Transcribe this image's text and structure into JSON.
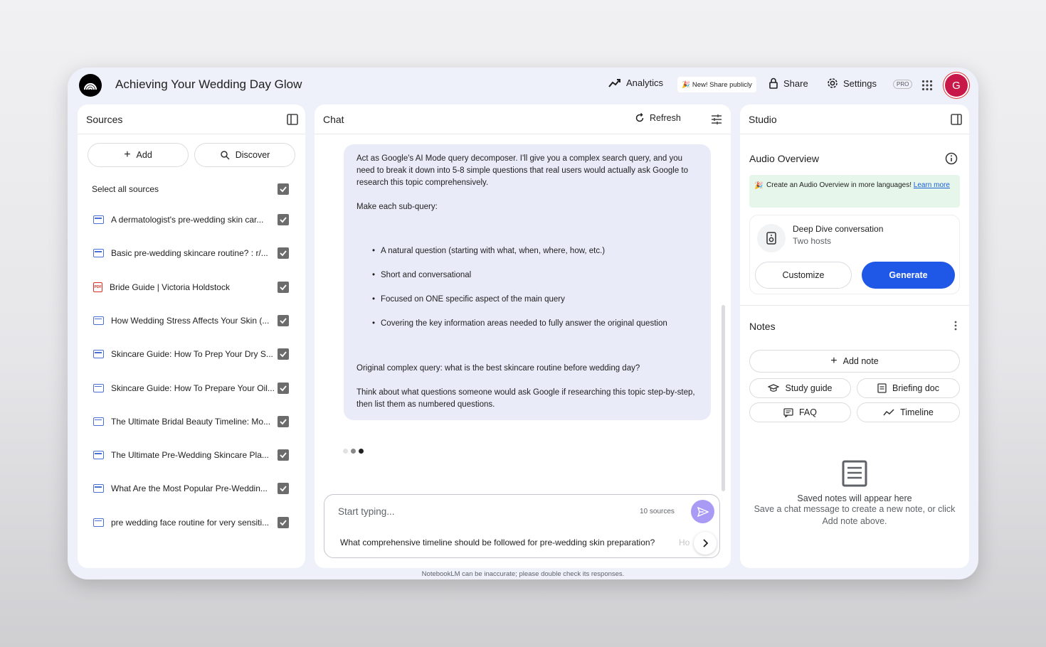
{
  "app": {
    "notebook_title": "Achieving Your Wedding Day Glow"
  },
  "header": {
    "analytics_label": "Analytics",
    "new_share_label": "New! Share publicly",
    "share_label": "Share",
    "settings_label": "Settings",
    "pro_badge": "PRO",
    "avatar_initial": "G"
  },
  "sources": {
    "title": "Sources",
    "add_label": "Add",
    "discover_label": "Discover",
    "select_all_label": "Select all sources",
    "items": [
      {
        "label": "A dermatologist's pre-wedding skin car...",
        "type": "web"
      },
      {
        "label": "Basic pre-wedding skincare routine? : r/...",
        "type": "web"
      },
      {
        "label": "Bride Guide | Victoria Holdstock",
        "type": "pdf"
      },
      {
        "label": "How Wedding Stress Affects Your Skin (...",
        "type": "web"
      },
      {
        "label": "Skincare Guide: How To Prep Your Dry S...",
        "type": "web"
      },
      {
        "label": "Skincare Guide: How To Prepare Your Oil...",
        "type": "web"
      },
      {
        "label": "The Ultimate Bridal Beauty Timeline: Mo...",
        "type": "web"
      },
      {
        "label": "The Ultimate Pre-Wedding Skincare Pla...",
        "type": "web"
      },
      {
        "label": "What Are the Most Popular Pre-Weddin...",
        "type": "web"
      },
      {
        "label": "pre wedding face routine for very sensiti...",
        "type": "web"
      }
    ]
  },
  "chat": {
    "title": "Chat",
    "refresh_label": "Refresh",
    "message": {
      "intro": "Act as Google's AI Mode query decomposer. I'll give you a complex search query, and you need to break it down into 5-8 simple questions that real users would actually ask Google to research this topic comprehensively.",
      "make_each": "Make each sub-query:",
      "bullets": [
        "A natural question (starting with what, when, where, how, etc.)",
        "Short and conversational",
        "Focused on ONE specific aspect of the main query",
        "Covering the key information areas needed to fully answer the original question"
      ],
      "original": "Original complex query: what is the best skincare routine before wedding day?",
      "think": "Think about what questions someone would ask Google if researching this topic step-by-step, then list them as numbered questions."
    },
    "input_placeholder": "Start typing...",
    "source_count": "10 sources",
    "suggestion": "What comprehensive timeline should be followed for pre-wedding skin preparation?",
    "suggestion_next": "Ho",
    "disclaimer": "NotebookLM can be inaccurate; please double check its responses."
  },
  "studio": {
    "title": "Studio",
    "audio_overview_title": "Audio Overview",
    "promo_text": "Create an Audio Overview in more languages!",
    "promo_link": "Learn more",
    "deep_dive_title": "Deep Dive conversation",
    "deep_dive_sub": "Two hosts",
    "customize_label": "Customize",
    "generate_label": "Generate",
    "notes_title": "Notes",
    "add_note_label": "Add note",
    "study_guide_label": "Study guide",
    "briefing_doc_label": "Briefing doc",
    "faq_label": "FAQ",
    "timeline_label": "Timeline",
    "empty_title": "Saved notes will appear here",
    "empty_sub": "Save a chat message to create a new note, or click Add note above."
  },
  "colors": {
    "accent": "#1f57e7",
    "send": "#a99bf5",
    "avatar": "#c8184a"
  }
}
